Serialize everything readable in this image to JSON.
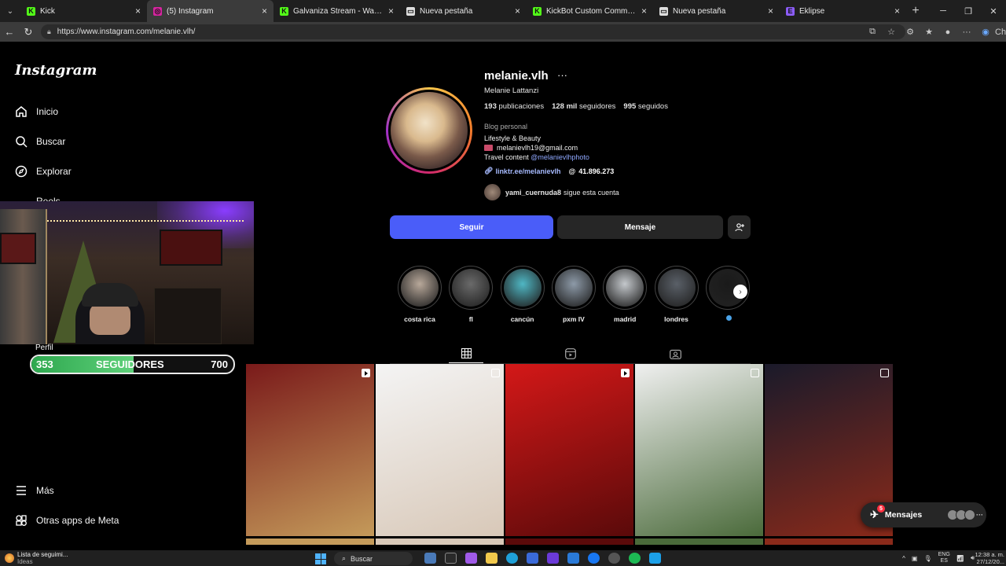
{
  "browser": {
    "tabs": [
      {
        "label": "Kick",
        "favicon_color": "#53fc18",
        "glyph": "K"
      },
      {
        "label": "(5) Instagram",
        "favicon_color": "#d6249f",
        "glyph": "◎",
        "active": true
      },
      {
        "label": "Galvaniza Stream - Watch Live on",
        "favicon_color": "#53fc18",
        "glyph": "K"
      },
      {
        "label": "Nueva pestaña",
        "favicon_color": "#dddddd",
        "glyph": "▭"
      },
      {
        "label": "KickBot Custom Commands",
        "favicon_color": "#53fc18",
        "glyph": "K"
      },
      {
        "label": "Nueva pestaña",
        "favicon_color": "#dddddd",
        "glyph": "▭"
      },
      {
        "label": "Eklipse",
        "favicon_color": "#8b5cf6",
        "glyph": "E"
      }
    ],
    "url": "https://www.instagram.com/melanie.vlh/",
    "profile_label": "Ch"
  },
  "sidebar": {
    "logo": "Instagram",
    "items": [
      {
        "label": "Inicio",
        "icon": "home-icon"
      },
      {
        "label": "Buscar",
        "icon": "search-icon"
      },
      {
        "label": "Explorar",
        "icon": "compass-icon"
      },
      {
        "label": "Reels",
        "icon": "reels-icon"
      },
      {
        "label": "Perfil",
        "icon": "avatar"
      },
      {
        "label": "Más",
        "icon": "menu-icon"
      },
      {
        "label": "Otras apps de Meta",
        "icon": "meta-apps-icon"
      }
    ]
  },
  "overlay": {
    "follower_goal": {
      "current": "353",
      "title": "SEGUIDORES",
      "target": "700",
      "progress": 0.504
    }
  },
  "profile": {
    "username": "melanie.vlh",
    "more": "···",
    "full_name": "Melanie Lattanzi",
    "stats": {
      "posts_value": "193",
      "posts_label": "publicaciones",
      "followers_value": "128 mil",
      "followers_label": "seguidores",
      "following_value": "995",
      "following_label": "seguidos"
    },
    "category": "Blog personal",
    "bio_line1": "Lifestyle & Beauty",
    "bio_email": "melanievlh19@gmail.com",
    "bio_line3_prefix": "Travel content ",
    "bio_mention": "@melanievlhphoto",
    "link": "linktr.ee/melanievlh",
    "threads_count": "41.896.273",
    "followed_by_user": "yami_cuernuda8",
    "followed_by_text": "sigue esta cuenta",
    "buttons": {
      "follow": "Seguir",
      "message": "Mensaje",
      "add_user": "+👤"
    }
  },
  "highlights": [
    {
      "label": "costa rica",
      "color": "#b8a89a"
    },
    {
      "label": "fl",
      "color": "#6a6a6a"
    },
    {
      "label": "cancún",
      "color": "#4fb7c4"
    },
    {
      "label": "pxm IV",
      "color": "#8d9aa8"
    },
    {
      "label": "madrid",
      "color": "#c4c8cc"
    },
    {
      "label": "londres",
      "color": "#5a6068"
    },
    {
      "label": "",
      "color": "#1a1a1a"
    }
  ],
  "posts": [
    {
      "type": "reel",
      "color_a": "#7a1a1a",
      "color_b": "#c49a5a"
    },
    {
      "type": "carousel",
      "color_a": "#f4f4f4",
      "color_b": "#d8c8b8"
    },
    {
      "type": "reel",
      "color_a": "#d41818",
      "color_b": "#5a0a0a"
    },
    {
      "type": "carousel",
      "color_a": "#f0f0f0",
      "color_b": "#4a6a3a"
    },
    {
      "type": "carousel",
      "color_a": "#1a1a2a",
      "color_b": "#8a2a1a"
    }
  ],
  "messages": {
    "label": "Mensajes",
    "badge": "5"
  },
  "taskbar": {
    "news_title": "Lista de seguimi...",
    "news_sub": "Ideas",
    "search": "Buscar",
    "lang_top": "ENG",
    "lang_bottom": "ES",
    "time": "12:38 a. m.",
    "date": "27/12/20..."
  }
}
